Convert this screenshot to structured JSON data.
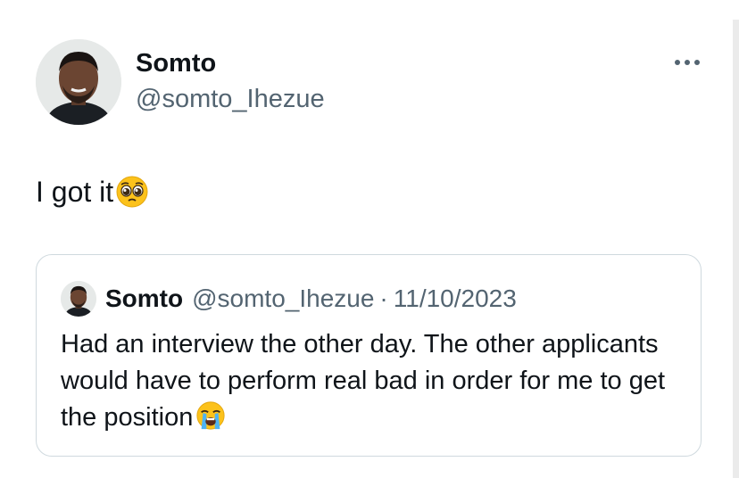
{
  "tweet": {
    "author_name": "Somto",
    "author_handle": "@somto_Ihezue",
    "text": "I got it",
    "text_emoji": "pleading-face",
    "more_icon": "more-horizontal-icon"
  },
  "quoted_tweet": {
    "author_name": "Somto",
    "author_handle": "@somto_Ihezue",
    "separator": "·",
    "date": "11/10/2023",
    "text": "Had an interview the other day. The other applicants would have to perform real bad in order for me to get the position",
    "text_emoji": "loudly-crying-face"
  },
  "colors": {
    "text": "#0f1419",
    "secondary": "#536471",
    "border": "#cfd9de"
  }
}
